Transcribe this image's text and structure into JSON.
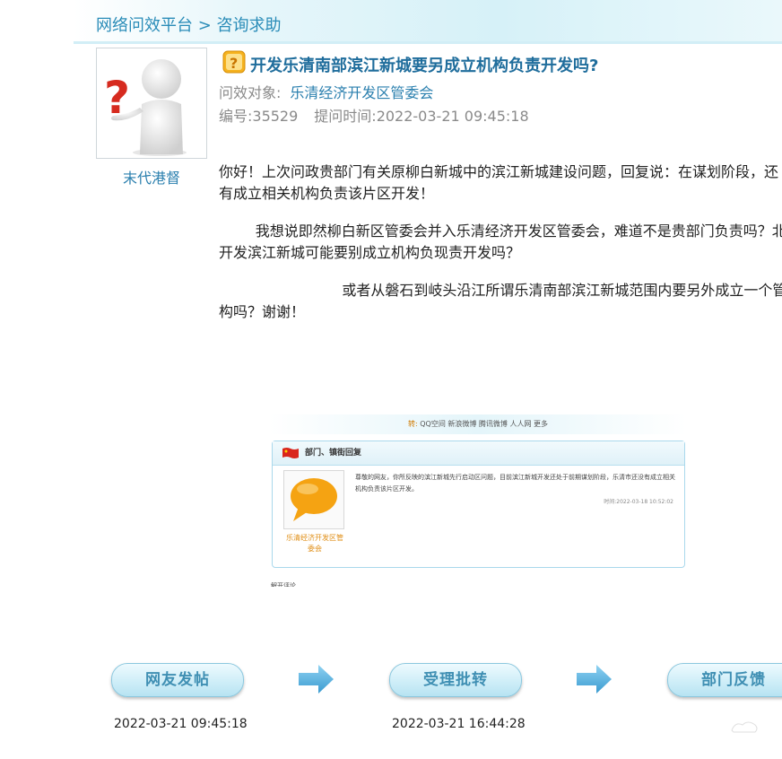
{
  "breadcrumb": "网络问效平台 > 咨询求助",
  "author": {
    "name": "末代港督"
  },
  "post": {
    "title": "开发乐清南部滨江新城要另成立机构负责开发吗?",
    "target_label": "问效对象:",
    "target": "乐清经济开发区管委会",
    "id_text": "编号:35529",
    "time_text": "提问时间:2022-03-21 09:45:18",
    "paragraphs": [
      {
        "line1": "你好！上次问政贵部门有关原柳白新城中的滨江新城建设问题，回复说：在谋划阶段，还",
        "line2": "有成立相关机构负责该片区开发！"
      },
      {
        "line1": "        我想说即然柳白新区管委会并入乐清经济开发区管委会，难道不是贵部门负责吗？北",
        "line2": "开发滨江新城可能要别成立机构负现责开发吗？"
      },
      {
        "line1": "                           或者从磐石到岐头沿江所谓乐清南部滨江新城范围内要另外成立一个管理",
        "line2": "构吗？谢谢！"
      }
    ]
  },
  "embedded": {
    "share_prefix": "转:",
    "share_links": "QQ空间 新浪微博 腾讯微博 人人网 更多",
    "panel_title": "部门、镇街回复",
    "dept_name": "乐清经济开发区管委会",
    "reply_text": "尊敬的网友，你所反映的滨江新城先行启动区问题，目前滨江新城开发还处于前期谋划阶段，乐清市还没有成立相关机构负责该片区开发。",
    "reply_time": "时间:2022-03-18 10:52:02",
    "cut_text": "解开评论"
  },
  "flow": {
    "steps": [
      {
        "label": "网友发帖",
        "time": "2022-03-21 09:45:18"
      },
      {
        "label": "受理批转",
        "time": "2022-03-21 16:44:28"
      },
      {
        "label": "部门反馈"
      }
    ]
  },
  "colors": {
    "accent": "#2a8cb8",
    "title": "#1f6d9c",
    "button_text": "#3f8fb3",
    "arrow": "#4aa8d8"
  }
}
